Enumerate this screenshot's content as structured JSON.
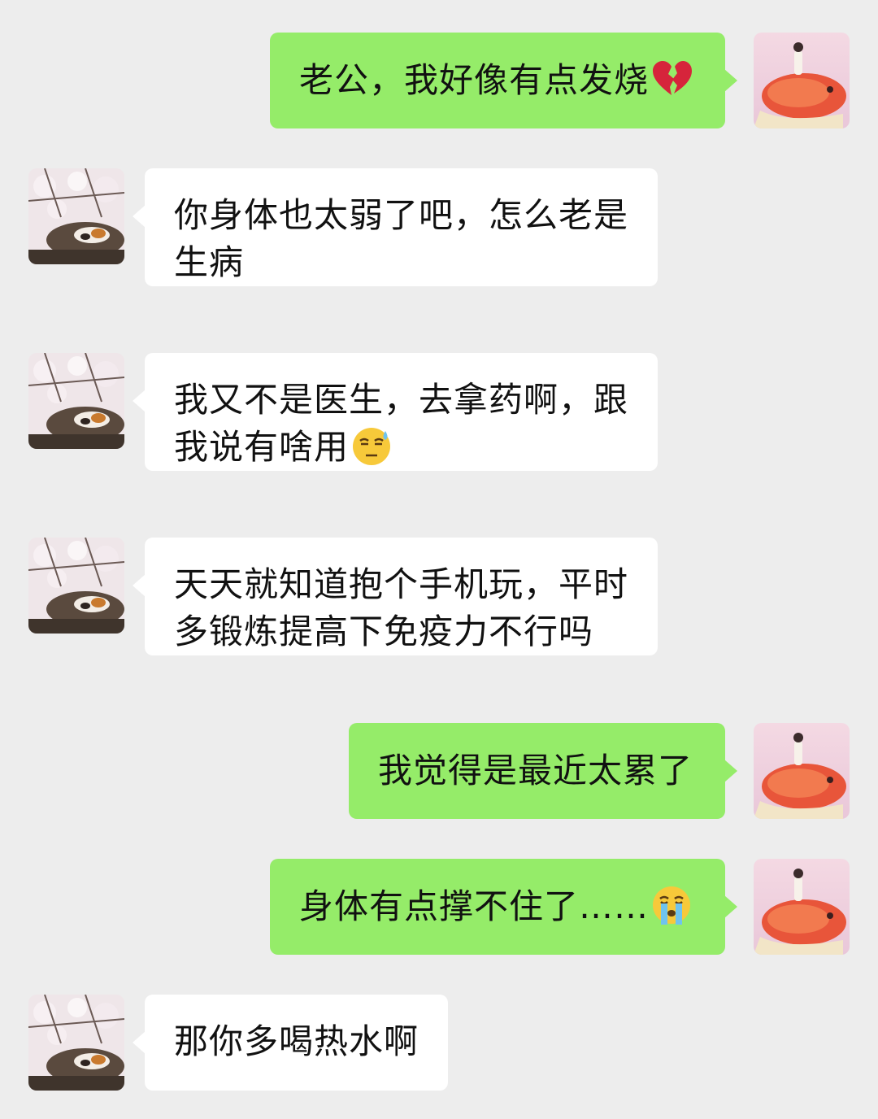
{
  "messages": [
    {
      "sender": "me",
      "avatar": "fish-girl-avatar",
      "lines": [
        "老公，我好像有点发烧"
      ],
      "emoji": "broken-heart"
    },
    {
      "sender": "other",
      "avatar": "cherry-blossom-cat-avatar",
      "lines": [
        "你身体也太弱了吧，怎么老是",
        "生病"
      ]
    },
    {
      "sender": "other",
      "avatar": "cherry-blossom-cat-avatar",
      "lines": [
        "我又不是医生，去拿药啊，跟",
        "我说有啥用"
      ],
      "emoji": "sweat-face"
    },
    {
      "sender": "other",
      "avatar": "cherry-blossom-cat-avatar",
      "lines": [
        "天天就知道抱个手机玩，平时",
        "多锻炼提高下免疫力不行吗"
      ]
    },
    {
      "sender": "me",
      "avatar": "fish-girl-avatar",
      "lines": [
        "我觉得是最近太累了"
      ]
    },
    {
      "sender": "me",
      "avatar": "fish-girl-avatar",
      "lines": [
        "身体有点撑不住了……"
      ],
      "emoji": "crying-face"
    },
    {
      "sender": "other",
      "avatar": "cherry-blossom-cat-avatar",
      "lines": [
        "那你多喝热水啊"
      ]
    }
  ],
  "colors": {
    "background": "#ededed",
    "sent_bubble": "#95ec69",
    "received_bubble": "#ffffff",
    "text": "#111111"
  }
}
